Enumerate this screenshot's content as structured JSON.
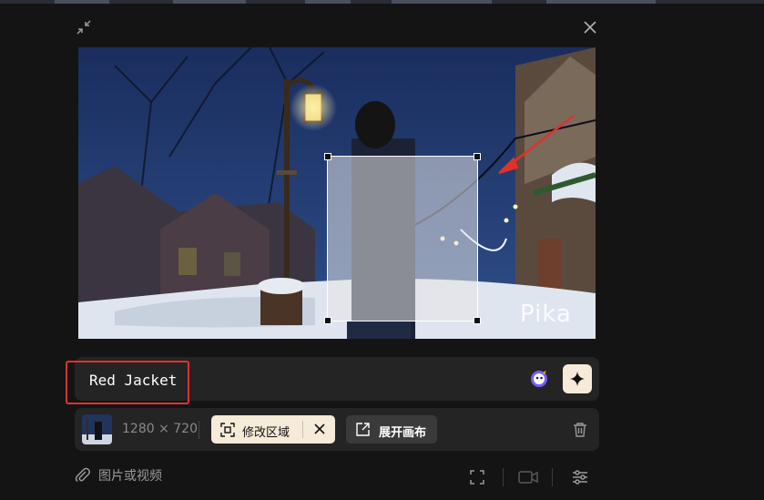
{
  "header": {
    "collapse_icon": "collapse-icon",
    "close_icon": "close-icon"
  },
  "preview": {
    "watermark": "Pika"
  },
  "prompt": {
    "text": "Red Jacket",
    "ai_icon": "ai-assistant-icon",
    "generate_icon": "sparkle-icon"
  },
  "info": {
    "resolution": "1280 × 720",
    "edit_region_label": "修改区域",
    "expand_canvas_label": "展开画布",
    "trash_icon": "trash-icon"
  },
  "footer": {
    "attach_label": "图片或视频",
    "icons": [
      "fullscreen-icon",
      "video-camera-icon",
      "settings-sliders-icon"
    ]
  },
  "colors": {
    "background": "#141414",
    "panel": "#242424",
    "accent_chip": "#f6ead8",
    "highlight_border": "#e0312b"
  }
}
